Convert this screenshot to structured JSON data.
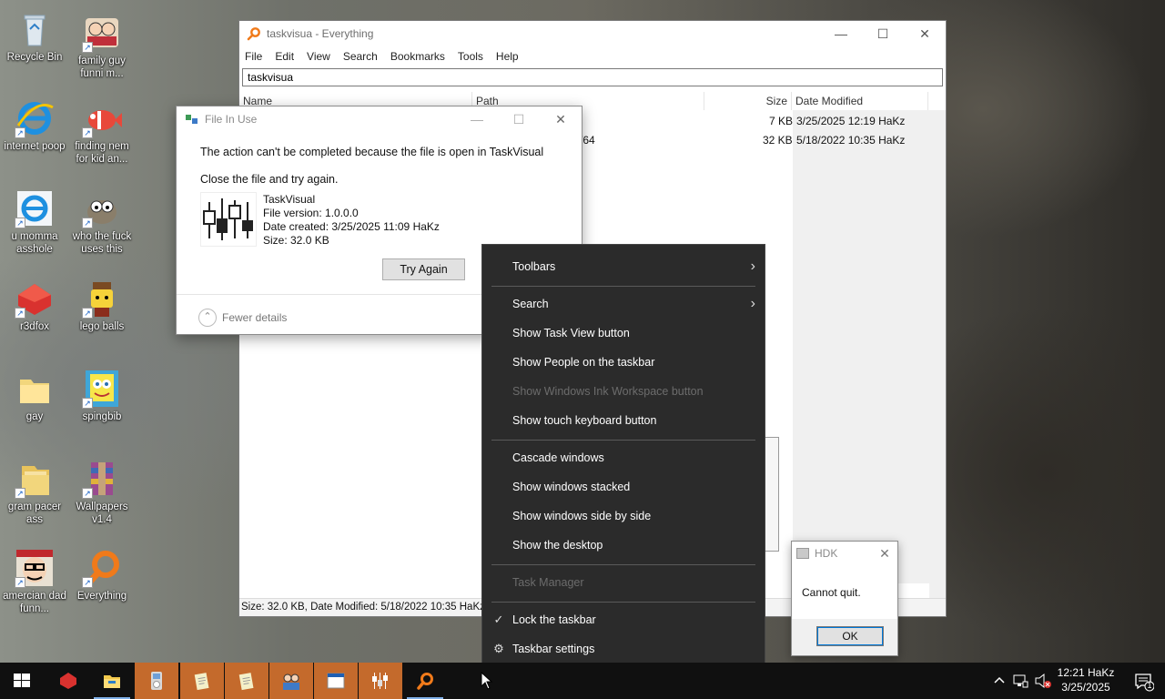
{
  "desktop": {
    "icons": [
      {
        "label": "Recycle Bin",
        "icon": "recycle-bin-icon"
      },
      {
        "label": "family guy funni m...",
        "icon": "family-guy-icon"
      },
      {
        "label": "internet poop",
        "icon": "internet-explorer-icon"
      },
      {
        "label": "finding nem for kid an...",
        "icon": "fish-icon"
      },
      {
        "label": "u momma asshole",
        "icon": "internet-explorer-icon"
      },
      {
        "label": "who the fuck uses this",
        "icon": "gimp-icon"
      },
      {
        "label": "r3dfox",
        "icon": "r3dfox-icon"
      },
      {
        "label": "lego balls",
        "icon": "lego-icon"
      },
      {
        "label": "gay",
        "icon": "folder-icon"
      },
      {
        "label": "spingbib",
        "icon": "spongebob-icon"
      },
      {
        "label": "gram pacer ass",
        "icon": "folder-icon"
      },
      {
        "label": "Wallpapers v1.4",
        "icon": "winrar-icon"
      },
      {
        "label": "amercian dad funn...",
        "icon": "american-dad-icon"
      },
      {
        "label": "Everything",
        "icon": "everything-icon"
      }
    ]
  },
  "everything": {
    "title": "taskvisua - Everything",
    "controls": {
      "minimize": "—",
      "maximize": "☐",
      "close": "✕"
    },
    "menu": [
      "File",
      "Edit",
      "View",
      "Search",
      "Bookmarks",
      "Tools",
      "Help"
    ],
    "search_value": "taskvisua",
    "columns": [
      "Name",
      "Path",
      "Size",
      "Date Modified"
    ],
    "rows": [
      {
        "path": "",
        "size": "7 KB",
        "date": "3/25/2025 12:19 HaKz"
      },
      {
        "path": "/64",
        "size": "32 KB",
        "date": "5/18/2022 10:35 HaKz"
      }
    ],
    "status": "Size: 32.0 KB, Date Modified: 5/18/2022 10:35 HaKz, P"
  },
  "file_in_use": {
    "title": "File In Use",
    "controls": {
      "minimize": "—",
      "maximize": "☐",
      "close": "✕"
    },
    "message": "The action can't be completed because the file is open in TaskVisual",
    "instruction": "Close the file and try again.",
    "file": {
      "name": "TaskVisual",
      "version": "File version: 1.0.0.0",
      "created": "Date created: 3/25/2025 11:09 HaKz",
      "size": "Size: 32.0 KB"
    },
    "try_again": "Try Again",
    "fewer_details": "Fewer details"
  },
  "hdk_dialog": {
    "title": "HDK",
    "close": "✕",
    "message": "Cannot quit.",
    "ok": "OK"
  },
  "context_menu": {
    "items": [
      {
        "label": "Toolbars",
        "submenu": "›",
        "disabled": false
      },
      {
        "label": "Search",
        "submenu": "›",
        "disabled": false
      },
      {
        "label": "Show Task View button",
        "disabled": false
      },
      {
        "label": "Show People on the taskbar",
        "disabled": false
      },
      {
        "label": "Show Windows Ink Workspace button",
        "disabled": true
      },
      {
        "label": "Show touch keyboard button",
        "disabled": false
      },
      {
        "label": "Cascade windows",
        "disabled": false
      },
      {
        "label": "Show windows stacked",
        "disabled": false
      },
      {
        "label": "Show windows side by side",
        "disabled": false
      },
      {
        "label": "Show the desktop",
        "disabled": false
      },
      {
        "label": "Task Manager",
        "disabled": true
      },
      {
        "label": "Lock the taskbar",
        "lead": "✓",
        "disabled": false
      },
      {
        "label": "Taskbar settings",
        "lead": "⚙",
        "disabled": false
      }
    ]
  },
  "taskbar": {
    "buttons": [
      "start-icon",
      "r3dfox-icon",
      "file-explorer-icon",
      "ipod-icon",
      "notepad-icon",
      "notepad-icon",
      "family-icon",
      "window-icon",
      "taskvisual-icon",
      "everything-icon"
    ],
    "clock_time": "12:21 HaKz",
    "clock_date": "3/25/2025",
    "notification_count": "1",
    "colors": {
      "taskbar": "#101010",
      "active": "#c46a2c",
      "accent": "#0078d7"
    }
  }
}
